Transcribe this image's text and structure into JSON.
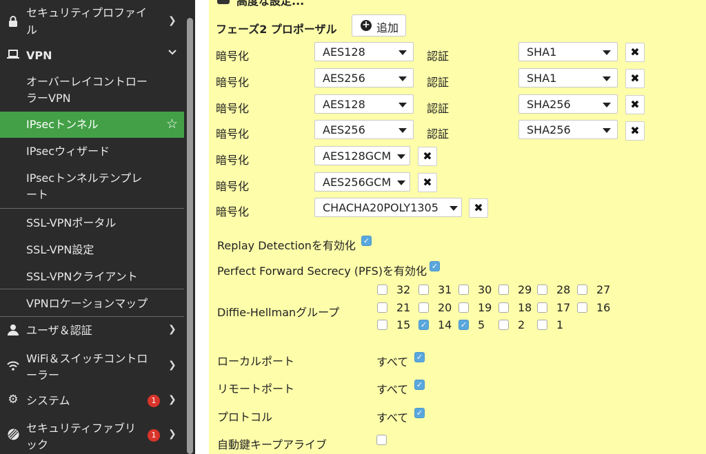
{
  "sidebar": {
    "items": [
      {
        "label_line1": "セキュリティプロファイ",
        "label_line2": "ル",
        "icon": "lock-icon"
      },
      {
        "label": "VPN",
        "icon": "laptop-icon"
      },
      {
        "label_line1": "オーバーレイコントロー",
        "label_line2": "ラーVPN"
      },
      {
        "label": "IPsecトンネル"
      },
      {
        "label": "IPsecウィザード"
      },
      {
        "label_line1": "IPsecトンネルテンプレ",
        "label_line2": "ート"
      },
      {
        "label": "SSL-VPNポータル"
      },
      {
        "label": "SSL-VPN設定"
      },
      {
        "label": "SSL-VPNクライアント"
      },
      {
        "label": "VPNロケーションマップ"
      },
      {
        "label": "ユーザ＆認証",
        "icon": "user-icon"
      },
      {
        "label_line1": "WiFi＆スイッチコントロ",
        "label_line2": "ーラー",
        "icon": "wifi-icon"
      },
      {
        "label": "システム",
        "icon": "gear-icon",
        "badge": "1"
      },
      {
        "label_line1": "セキュリティファブリ",
        "label_line2": "ック",
        "icon": "fabric-icon",
        "badge": "1"
      }
    ],
    "active_color": "#43a047"
  },
  "main": {
    "advanced_label": "高度な設定...",
    "phase2_title": "フェーズ2 プロポーザル",
    "add_label": "追加",
    "enc_label": "暗号化",
    "auth_label": "認証",
    "proposals": [
      {
        "enc": "AES128",
        "auth": "SHA1"
      },
      {
        "enc": "AES256",
        "auth": "SHA1"
      },
      {
        "enc": "AES128",
        "auth": "SHA256"
      },
      {
        "enc": "AES256",
        "auth": "SHA256"
      },
      {
        "enc": "AES128GCM"
      },
      {
        "enc": "AES256GCM"
      },
      {
        "enc": "CHACHA20POLY1305"
      }
    ],
    "replay_label": "Replay Detectionを有効化",
    "replay_checked": true,
    "pfs_label": "Perfect Forward Secrecy (PFS)を有効化",
    "pfs_checked": true,
    "dh_label": "Diffie-Hellmanグループ",
    "dh_groups": [
      {
        "n": "32",
        "on": false
      },
      {
        "n": "31",
        "on": false
      },
      {
        "n": "30",
        "on": false
      },
      {
        "n": "29",
        "on": false
      },
      {
        "n": "28",
        "on": false
      },
      {
        "n": "27",
        "on": false
      },
      {
        "n": "21",
        "on": false
      },
      {
        "n": "20",
        "on": false
      },
      {
        "n": "19",
        "on": false
      },
      {
        "n": "18",
        "on": false
      },
      {
        "n": "17",
        "on": false
      },
      {
        "n": "16",
        "on": false
      },
      {
        "n": "15",
        "on": false
      },
      {
        "n": "14",
        "on": true
      },
      {
        "n": "5",
        "on": true
      },
      {
        "n": "2",
        "on": false
      },
      {
        "n": "1",
        "on": false
      }
    ],
    "local_port_label": "ローカルポート",
    "remote_port_label": "リモートポート",
    "protocol_label": "プロトコル",
    "all_label": "すべて",
    "autokey_label": "自動鍵キープアライブ",
    "autokey_checked": false,
    "background": "#fdfdaa"
  }
}
